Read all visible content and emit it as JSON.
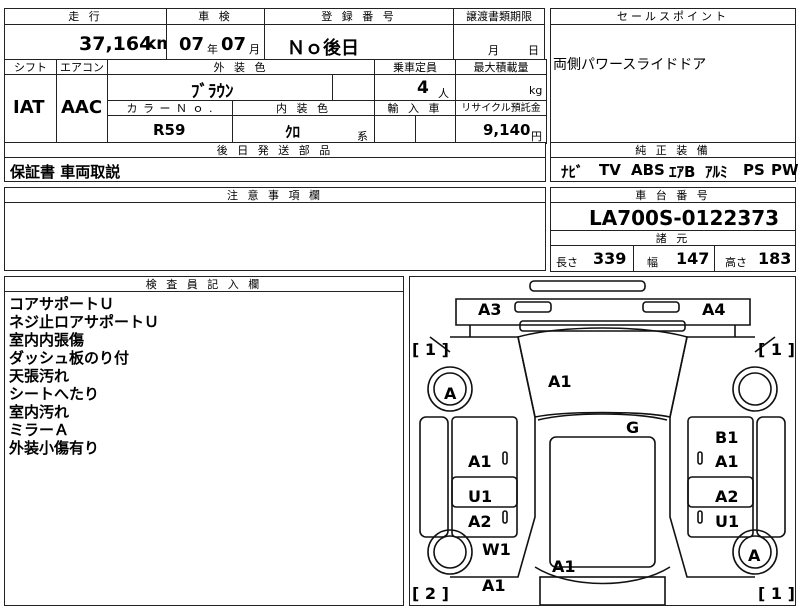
{
  "header": {
    "mileage_label": "走 行",
    "inspection_label": "車 検",
    "registration_label": "登 録 番 号",
    "transfer_label": "譲渡書類期限",
    "sales_point_label": "セールスポイント"
  },
  "values": {
    "mileage": "37,164",
    "mileage_unit": "km",
    "inspection_year": "07",
    "inspection_year_unit": "年",
    "inspection_month": "07",
    "inspection_month_unit": "月",
    "registration": "Ｎｏ後日",
    "transfer_month_unit": "月",
    "transfer_day_unit": "日",
    "sales_point": "両側パワースライドドア"
  },
  "spec": {
    "shift_label": "シフト",
    "ac_label": "エアコン",
    "exterior_label": "外 装 色",
    "capacity_label": "乗車定員",
    "max_load_label": "最大積載量",
    "shift": "IAT",
    "ac": "AAC",
    "exterior_color": "ﾌﾞﾗｳﾝ",
    "capacity": "4",
    "capacity_unit": "人",
    "load_unit": "kg",
    "color_no_label": "カ ラ ー Ｎ ｏ .",
    "interior_label": "内 装 色",
    "import_label": "輸 入 車",
    "recycle_label": "リサイクル預託金",
    "color_no": "R59",
    "interior_color": "ｸﾛ",
    "interior_suffix": "系",
    "recycle_fee": "9,140",
    "recycle_unit": "円"
  },
  "later_parts": {
    "label": "後 日 発 送 部 品",
    "value": "保証書 車両取説"
  },
  "equipment": {
    "label": "純 正 装 備",
    "items": [
      "ﾅﾋﾞ",
      "TV",
      "ABS",
      "ｴｱB",
      "ｱﾙﾐ",
      "PS",
      "PW"
    ]
  },
  "notes": {
    "label": "注 意 事 項 欄",
    "value": ""
  },
  "chassis": {
    "label": "車 台 番 号",
    "value": "LA700S-0122373",
    "dims_label": "諸 元",
    "length_label": "長さ",
    "length": "339",
    "width_label": "幅",
    "width": "147",
    "height_label": "高さ",
    "height": "183"
  },
  "inspector": {
    "label": "検 査 員 記 入 欄",
    "lines": [
      "コアサポートＵ",
      "ネジ止ロアサポートＵ",
      "室内内張傷",
      "ダッシュ板のり付",
      "天張汚れ",
      "シートへたり",
      "室内汚れ",
      "ミラーＡ",
      "外装小傷有り"
    ]
  },
  "diagram": {
    "marks": {
      "a3": "A3",
      "a4": "A4",
      "r1_left": "[ 1 ]",
      "r1_right": "[ 1 ]",
      "r2_left": "[ 2 ]",
      "r2_right": "[ 1 ]",
      "tire_fl": "A",
      "tire_rr": "A",
      "hood": "A1",
      "roof": "G",
      "door_fl": "A1",
      "door_fr_top": "B1",
      "door_fr": "A1",
      "door_rl_top": "U1",
      "door_rl": "A2",
      "door_rr_top": "A2",
      "door_rr": "U1",
      "rear_w1": "W1",
      "rear_a1_left": "A1",
      "rear_a1_center": "A1"
    }
  }
}
